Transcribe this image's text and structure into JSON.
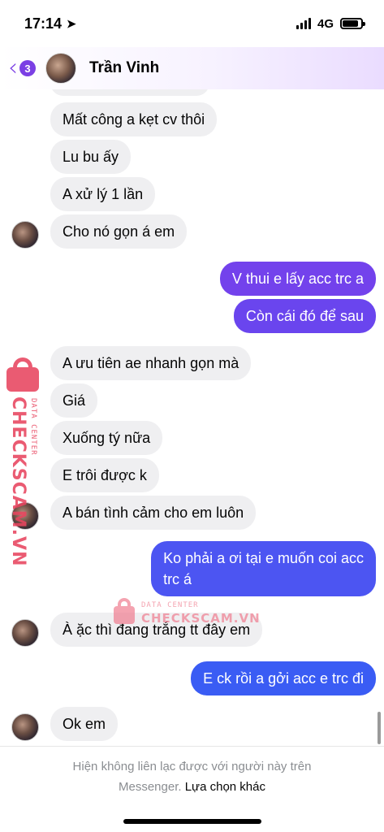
{
  "status_bar": {
    "time": "17:14",
    "network": "4G"
  },
  "header": {
    "back_count": "3",
    "contact_name": "Trần Vinh"
  },
  "colors": {
    "accent": "#7b3fe4",
    "bubble_out_top": "#7b3fe4",
    "bubble_out_bottom": "#2f5ff5",
    "bubble_in": "#efeff1"
  },
  "messages": [
    {
      "dir": "in",
      "text": "Mất công a kẹt cv thôi"
    },
    {
      "dir": "in",
      "text": "Lu bu ấy"
    },
    {
      "dir": "in",
      "text": "A xử lý 1 lần"
    },
    {
      "dir": "in",
      "text": "Cho nó gọn á em"
    },
    {
      "dir": "out",
      "text": "V thui e lấy acc trc a"
    },
    {
      "dir": "out",
      "text": "Còn cái đó để sau"
    },
    {
      "dir": "in",
      "text": "A ưu tiên ae nhanh gọn mà"
    },
    {
      "dir": "in",
      "text": "Giá"
    },
    {
      "dir": "in",
      "text": "Xuống tý nữa"
    },
    {
      "dir": "in",
      "text": "E trôi được k"
    },
    {
      "dir": "in",
      "text": "A bán tình cảm cho em luôn"
    },
    {
      "dir": "out",
      "text_line1": "Ko phải a ơi tại e muốn coi acc",
      "text_line2": "trc á"
    },
    {
      "dir": "in",
      "text": "À ặc thì đang trắng tt đây em"
    },
    {
      "dir": "out",
      "text": "E ck rồi a gởi acc e trc đi"
    },
    {
      "dir": "in",
      "text": "Ok em"
    }
  ],
  "watermark": {
    "brand": "CHECKSCAM.VN",
    "tagline": "DATA CENTER"
  },
  "footer": {
    "notice_line1": "Hiện không liên lạc được với người này trên",
    "notice_line2": "Messenger.",
    "link": "Lựa chọn khác"
  }
}
